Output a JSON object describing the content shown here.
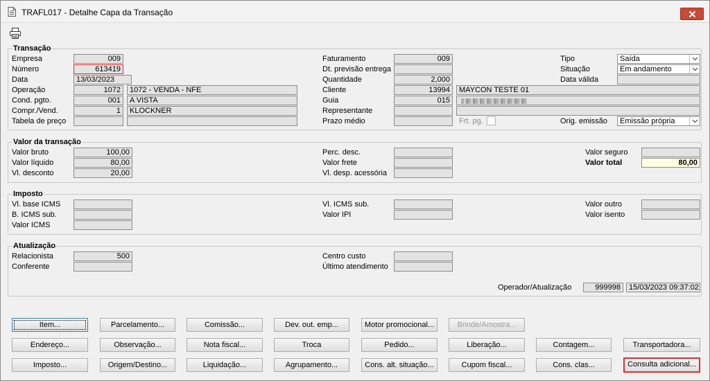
{
  "window": {
    "title": "TRAFL017 - Detalhe Capa da Transação"
  },
  "toolbar": {
    "print_icon": "printer-icon"
  },
  "transacao": {
    "legend": "Transação",
    "labels": {
      "empresa": "Empresa",
      "numero": "Número",
      "data": "Data",
      "operacao": "Operação",
      "cond_pgto": "Cond. pgto.",
      "compr_vend": "Compr./Vend.",
      "tabela_preco": "Tabela de preço",
      "faturamento": "Faturamento",
      "dt_previsao": "Dt. previsão entrega",
      "quantidade": "Quantidade",
      "cliente": "Cliente",
      "guia": "Guia",
      "representante": "Representante",
      "prazo_medio": "Prazo médio",
      "frt_pg": "Frt. pg.",
      "tipo": "Tipo",
      "situacao": "Situação",
      "data_valida": "Data válida",
      "orig_emissao": "Orig. emissão"
    },
    "values": {
      "empresa": "009",
      "numero": "613419",
      "data": "13/03/2023",
      "operacao_code": "1072",
      "operacao_desc": "1072 - VENDA - NFE",
      "cond_pgto_code": "001",
      "cond_pgto_desc": "A VISTA",
      "compr_vend_code": "1",
      "compr_vend_desc": "KLOCKNER",
      "tabela_preco_code": "",
      "tabela_preco_desc": "",
      "faturamento": "009",
      "dt_previsao": "",
      "quantidade": "2,000",
      "cliente_code": "13994",
      "cliente_name": "MAYCON TESTE 01",
      "guia_code": "015",
      "representante_code": "",
      "representante_name": "",
      "prazo_medio": "",
      "tipo": "Saída",
      "situacao": "Em andamento",
      "data_valida": "",
      "orig_emissao": "Emissão própria"
    }
  },
  "valor_transacao": {
    "legend": "Valor da transação",
    "labels": {
      "valor_bruto": "Valor bruto",
      "valor_liquido": "Valor líquido",
      "vl_desconto": "Vl. desconto",
      "perc_desc": "Perc. desc.",
      "valor_frete": "Valor frete",
      "vl_desp_acessoria": "Vl. desp. acessória",
      "valor_seguro": "Valor seguro",
      "valor_total": "Valor total"
    },
    "values": {
      "valor_bruto": "100,00",
      "valor_liquido": "80,00",
      "vl_desconto": "20,00",
      "perc_desc": "",
      "valor_frete": "",
      "vl_desp_acessoria": "",
      "valor_seguro": "",
      "valor_total": "80,00"
    }
  },
  "imposto": {
    "legend": "Imposto",
    "labels": {
      "vl_base_icms": "Vl. base ICMS",
      "b_icms_sub": "B. ICMS sub.",
      "valor_icms": "Valor ICMS",
      "vl_icms_sub": "Vl. ICMS sub.",
      "valor_ipi": "Valor IPI",
      "valor_outro": "Valor outro",
      "valor_isento": "Valor isento"
    }
  },
  "atualizacao": {
    "legend": "Atualização",
    "labels": {
      "relacionista": "Relacionista",
      "conferente": "Conferente",
      "centro_custo": "Centro custo",
      "ultimo_atendimento": "Último atendimento",
      "operador_atualizacao": "Operador/Atualização"
    },
    "values": {
      "relacionista": "500",
      "conferente": "",
      "centro_custo": "",
      "ultimo_atendimento": "",
      "operador": "999998",
      "data_atualizacao": "15/03/2023 09:37:02"
    }
  },
  "buttons": {
    "item": "Item...",
    "parcelamento": "Parcelamento...",
    "comissao": "Comissão...",
    "dev_out_emp": "Dev. out. emp...",
    "motor_promocional": "Motor promocional...",
    "brinde_amostra": "Brinde/Amostra...",
    "endereco": "Endereço...",
    "observacao": "Observação...",
    "nota_fiscal": "Nota fiscal...",
    "troca": "Troca",
    "pedido": "Pedido...",
    "liberacao": "Liberação...",
    "contagem": "Contagem...",
    "transportadora": "Transportadora...",
    "imposto": "Imposto...",
    "origem_destino": "Origem/Destino...",
    "liquidacao": "Liquidação...",
    "agrupamento": "Agrupamento...",
    "cons_alt_situacao": "Cons. alt. situação...",
    "cupom_fiscal": "Cupom fiscal...",
    "cons_clas": "Cons. clas...",
    "consulta_adicional": "Consulta adicional..."
  }
}
